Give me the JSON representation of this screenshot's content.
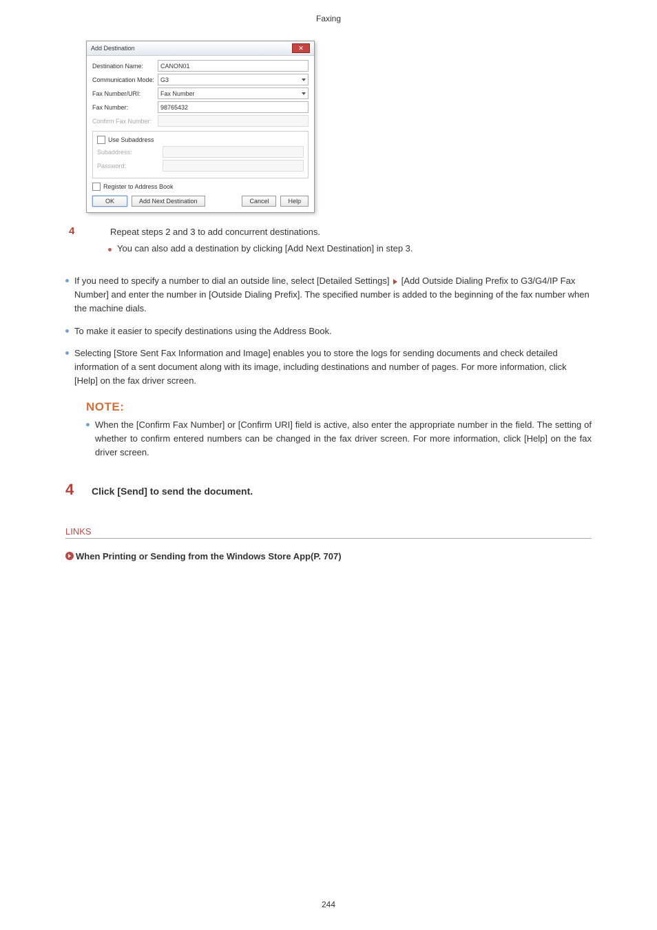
{
  "header": {
    "title": "Faxing"
  },
  "dialog": {
    "title": "Add Destination",
    "rows": {
      "dest_name": {
        "label": "Destination Name:",
        "value": "CANON01"
      },
      "comm_mode": {
        "label": "Communication Mode:",
        "value": "G3"
      },
      "fax_num_uri": {
        "label": "Fax Number/URI:",
        "value": "Fax Number"
      },
      "fax_number": {
        "label": "Fax Number:",
        "value": "98765432"
      },
      "confirm_fax": {
        "label": "Confirm Fax Number:",
        "value": ""
      }
    },
    "subaddress_box": {
      "chk_label": "Use Subaddress",
      "subaddress_label": "Subaddress:",
      "password_label": "Password:"
    },
    "register_label": "Register to Address Book",
    "buttons": {
      "ok": "OK",
      "add_next": "Add Next Destination",
      "cancel": "Cancel",
      "help": "Help"
    }
  },
  "substep4": {
    "num": "4",
    "text": "Repeat steps 2 and 3 to add concurrent destinations.",
    "sub": "You can also add a destination by clicking [Add Next Destination] in step 3."
  },
  "bullets": {
    "b1a": "If you need to specify a number to dial an outside line, select [Detailed Settings] ",
    "b1b": " [Add Outside Dialing Prefix to G3/G4/IP Fax Number] and enter the number in [Outside Dialing Prefix]. The specified number is added to the beginning of the fax number when the machine dials.",
    "b2": "To make it easier to specify destinations using the Address Book.",
    "b3": "Selecting [Store Sent Fax Information and Image] enables you to store the logs for sending documents and check detailed information of a sent document along with its image, including destinations and number of pages. For more information, click [Help] on the fax driver screen."
  },
  "note": {
    "head": "NOTE:",
    "body": "When the [Confirm Fax Number] or [Confirm URI] field is active, also enter the appropriate number in the field. The setting of whether to confirm entered numbers can be changed in the fax driver screen. For more information, click [Help] on the fax driver screen."
  },
  "step4": {
    "num": "4",
    "text": "Click [Send] to send the document."
  },
  "links": {
    "head": "LINKS",
    "item": "When Printing or Sending from the Windows Store App(P. 707)"
  },
  "pagenum": "244"
}
